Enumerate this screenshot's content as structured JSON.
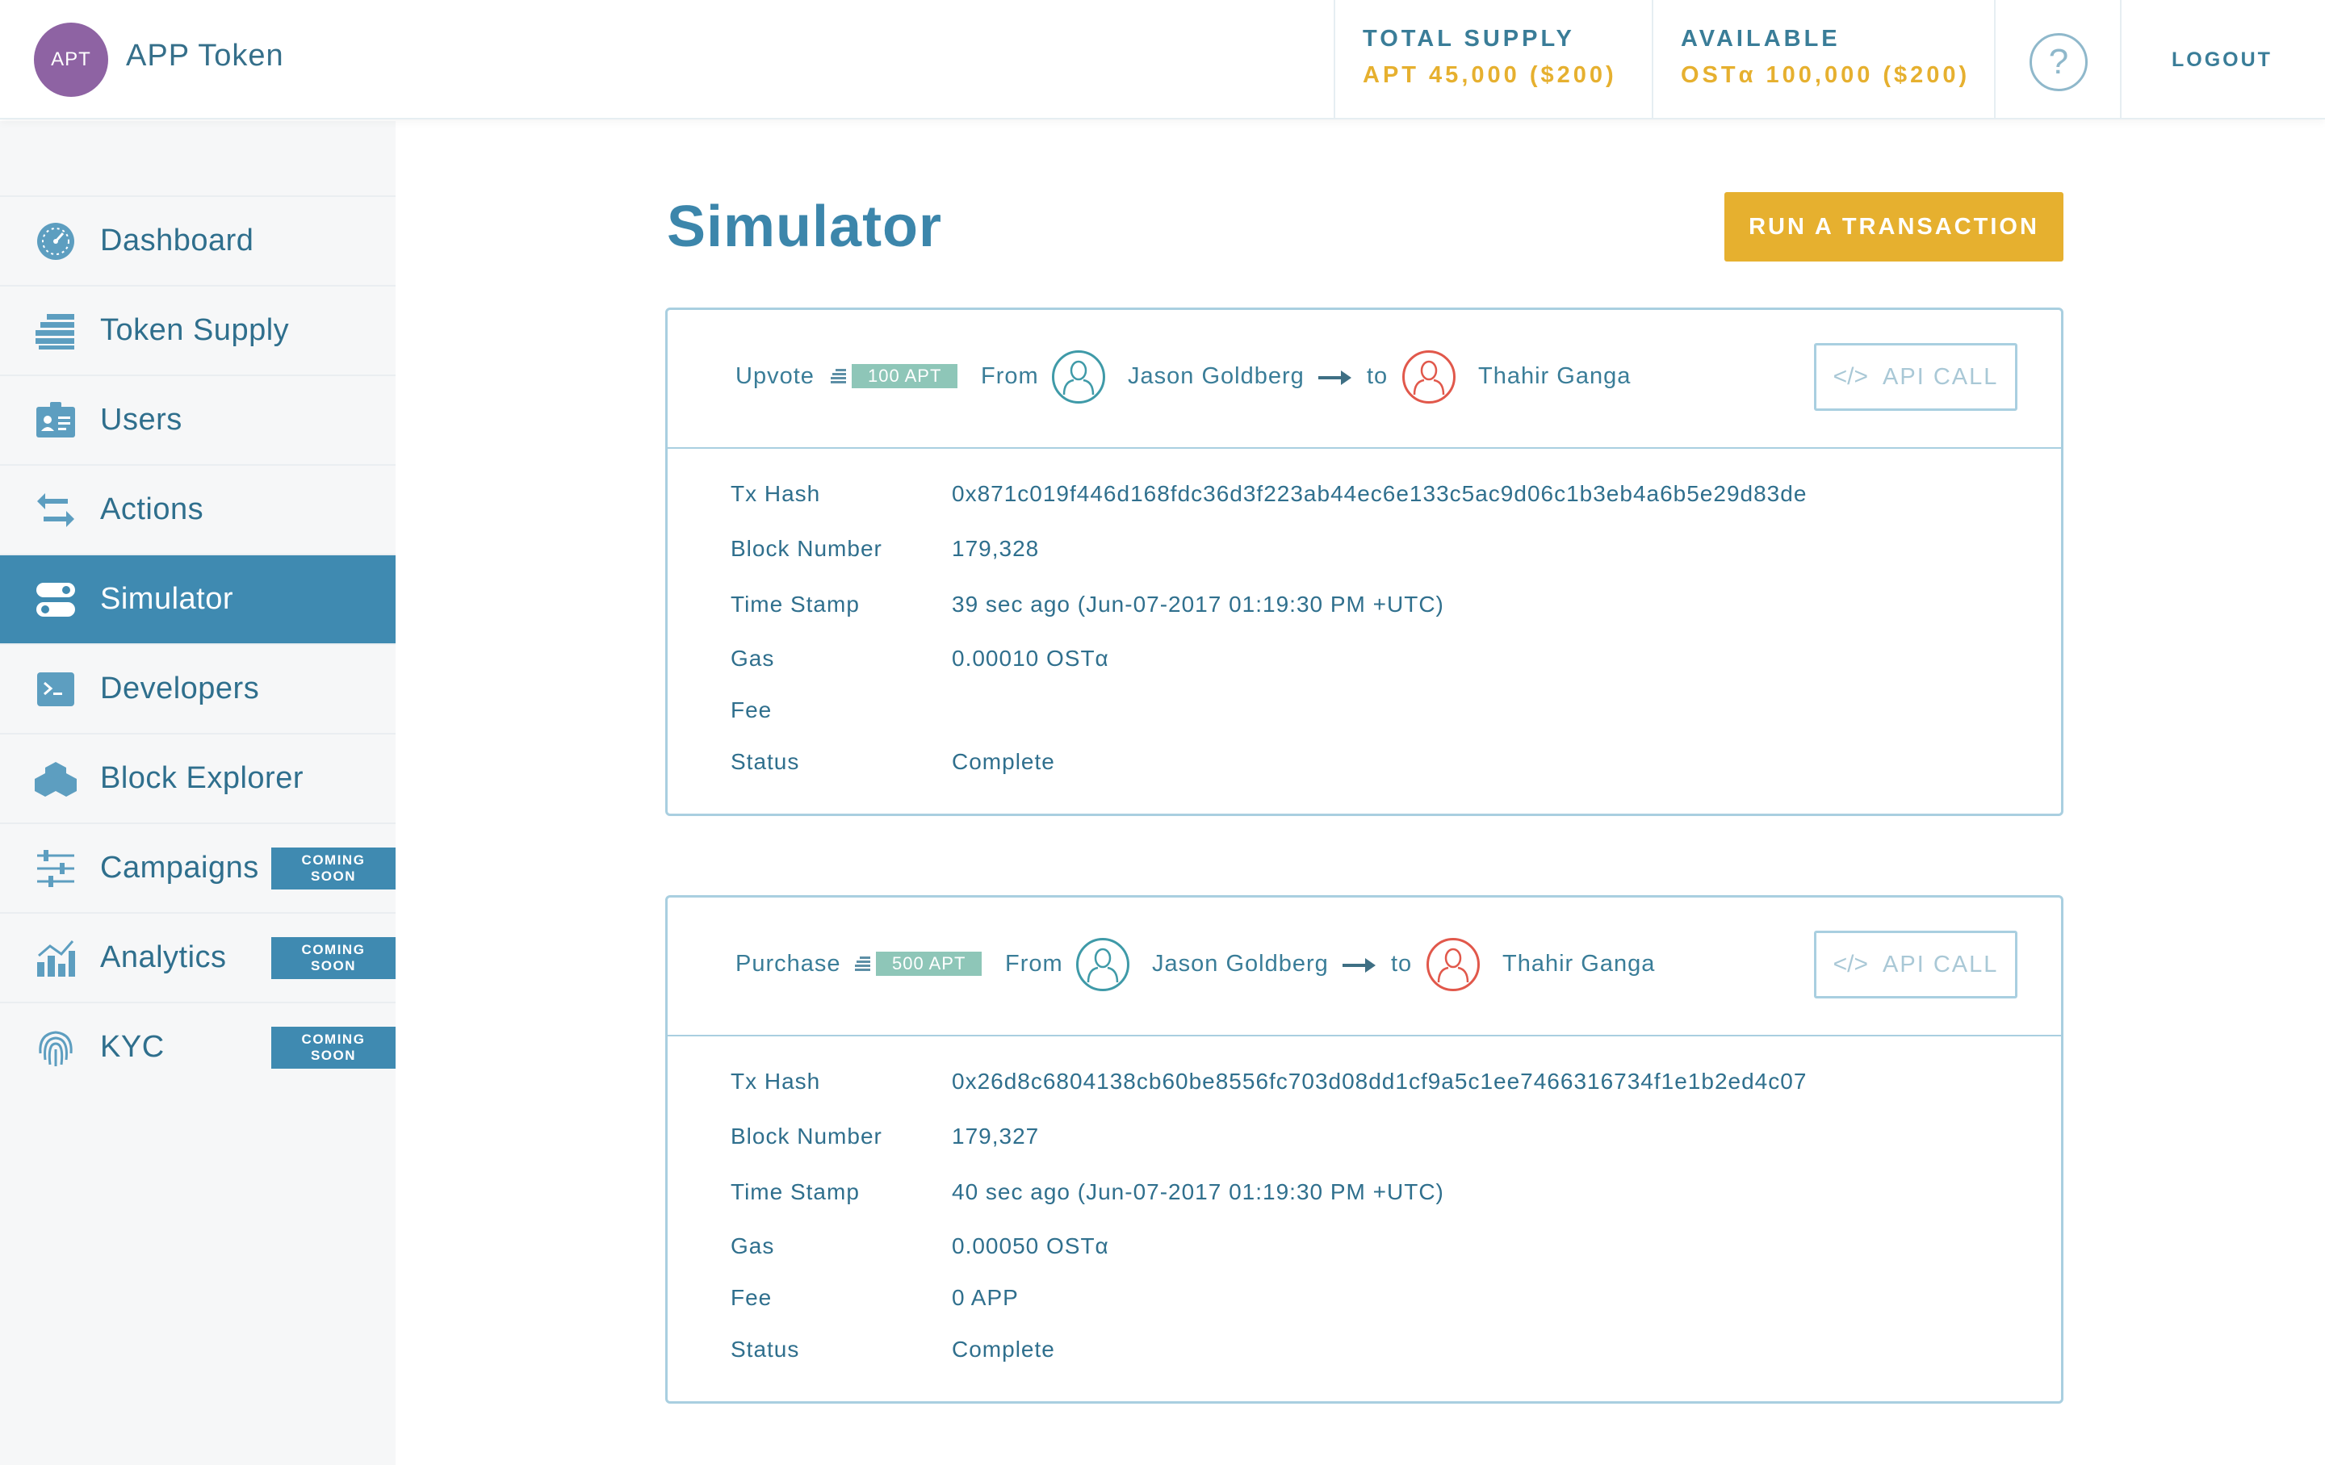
{
  "header": {
    "avatar_text": "APT",
    "app_name": "APP Token",
    "total_supply_label": "TOTAL SUPPLY",
    "total_supply_value": "APT 45,000 ($200)",
    "available_label": "AVAILABLE",
    "available_value": "OSTα 100,000 ($200)",
    "help_glyph": "?",
    "logout_label": "LOGOUT"
  },
  "sidebar": {
    "items": [
      {
        "label": "Dashboard",
        "icon": "dashboard-gauge-icon",
        "active": false,
        "badge": ""
      },
      {
        "label": "Token Supply",
        "icon": "token-supply-stack-icon",
        "active": false,
        "badge": ""
      },
      {
        "label": "Users",
        "icon": "users-idcard-icon",
        "active": false,
        "badge": ""
      },
      {
        "label": "Actions",
        "icon": "actions-arrows-icon",
        "active": false,
        "badge": ""
      },
      {
        "label": "Simulator",
        "icon": "simulator-toggle-icon",
        "active": true,
        "badge": ""
      },
      {
        "label": "Developers",
        "icon": "developers-terminal-icon",
        "active": false,
        "badge": ""
      },
      {
        "label": "Block Explorer",
        "icon": "block-explorer-cubes-icon",
        "active": false,
        "badge": ""
      },
      {
        "label": "Campaigns",
        "icon": "campaigns-sliders-icon",
        "active": false,
        "badge": "COMING SOON"
      },
      {
        "label": "Analytics",
        "icon": "analytics-chart-icon",
        "active": false,
        "badge": "COMING SOON"
      },
      {
        "label": "KYC",
        "icon": "kyc-fingerprint-icon",
        "active": false,
        "badge": "COMING SOON"
      }
    ]
  },
  "main": {
    "title": "Simulator",
    "run_button_label": "RUN A TRANSACTION",
    "transactions": [
      {
        "action": "Upvote",
        "amount": "100 APT",
        "from_label": "From",
        "from_user": "Jason Goldberg",
        "to_label": "to",
        "to_user": "Thahir Ganga",
        "api_label": "API CALL",
        "fields": [
          {
            "key": "Tx Hash",
            "value": "0x871c019f446d168fdc36d3f223ab44ec6e133c5ac9d06c1b3eb4a6b5e29d83de"
          },
          {
            "key": "Block Number",
            "value": "179,328"
          },
          {
            "key": "Time Stamp",
            "value": "39 sec ago (Jun-07-2017   01:19:30 PM +UTC)"
          },
          {
            "key": "Gas",
            "value": "0.00010 OSTα"
          },
          {
            "key": "Fee",
            "value": ""
          },
          {
            "key": "Status",
            "value": "Complete"
          }
        ]
      },
      {
        "action": "Purchase",
        "amount": "500 APT",
        "from_label": "From",
        "from_user": "Jason Goldberg",
        "to_label": "to",
        "to_user": "Thahir Ganga",
        "api_label": "API CALL",
        "fields": [
          {
            "key": "Tx Hash",
            "value": "0x26d8c6804138cb60be8556fc703d08dd1cf9a5c1ee7466316734f1e1b2ed4c07"
          },
          {
            "key": "Block Number",
            "value": "179,327"
          },
          {
            "key": "Time Stamp",
            "value": "40 sec ago (Jun-07-2017   01:19:30 PM +UTC)"
          },
          {
            "key": "Gas",
            "value": "0.00050 OSTα"
          },
          {
            "key": "Fee",
            "value": "0 APP"
          },
          {
            "key": "Status",
            "value": "Complete"
          }
        ]
      }
    ]
  },
  "colors": {
    "brand_teal": "#3f8ab1",
    "accent_gold": "#e6b02f",
    "avatar_purple": "#8e63a3",
    "sender_teal": "#3f9aa8",
    "receiver_red": "#e1584b",
    "amount_green": "#8ec6b8"
  }
}
